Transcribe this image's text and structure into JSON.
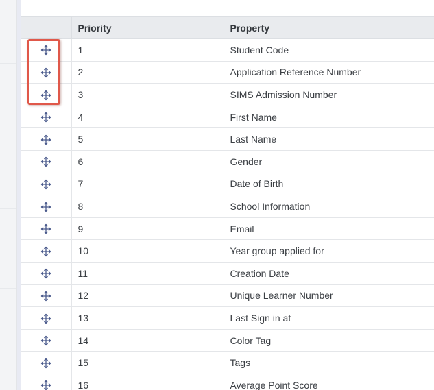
{
  "table": {
    "columns": {
      "handle": "",
      "priority": "Priority",
      "property": "Property"
    },
    "rows": [
      {
        "priority": "1",
        "property": "Student Code"
      },
      {
        "priority": "2",
        "property": "Application Reference Number"
      },
      {
        "priority": "3",
        "property": "SIMS Admission Number"
      },
      {
        "priority": "4",
        "property": "First Name"
      },
      {
        "priority": "5",
        "property": "Last Name"
      },
      {
        "priority": "6",
        "property": "Gender"
      },
      {
        "priority": "7",
        "property": "Date of Birth"
      },
      {
        "priority": "8",
        "property": "School Information"
      },
      {
        "priority": "9",
        "property": "Email"
      },
      {
        "priority": "10",
        "property": "Year group applied for"
      },
      {
        "priority": "11",
        "property": "Creation Date"
      },
      {
        "priority": "12",
        "property": "Unique Learner Number"
      },
      {
        "priority": "13",
        "property": "Last Sign in at"
      },
      {
        "priority": "14",
        "property": "Color Tag"
      },
      {
        "priority": "15",
        "property": "Tags"
      },
      {
        "priority": "16",
        "property": "Average Point Score"
      }
    ],
    "row_icon": "move-icon"
  },
  "highlight": {
    "covers_rows": [
      "1",
      "2",
      "3"
    ],
    "color": "#e0584a"
  },
  "colors": {
    "icon": "#4a5a8c",
    "header_bg": "#e9ebee",
    "text": "#3b3f44"
  }
}
